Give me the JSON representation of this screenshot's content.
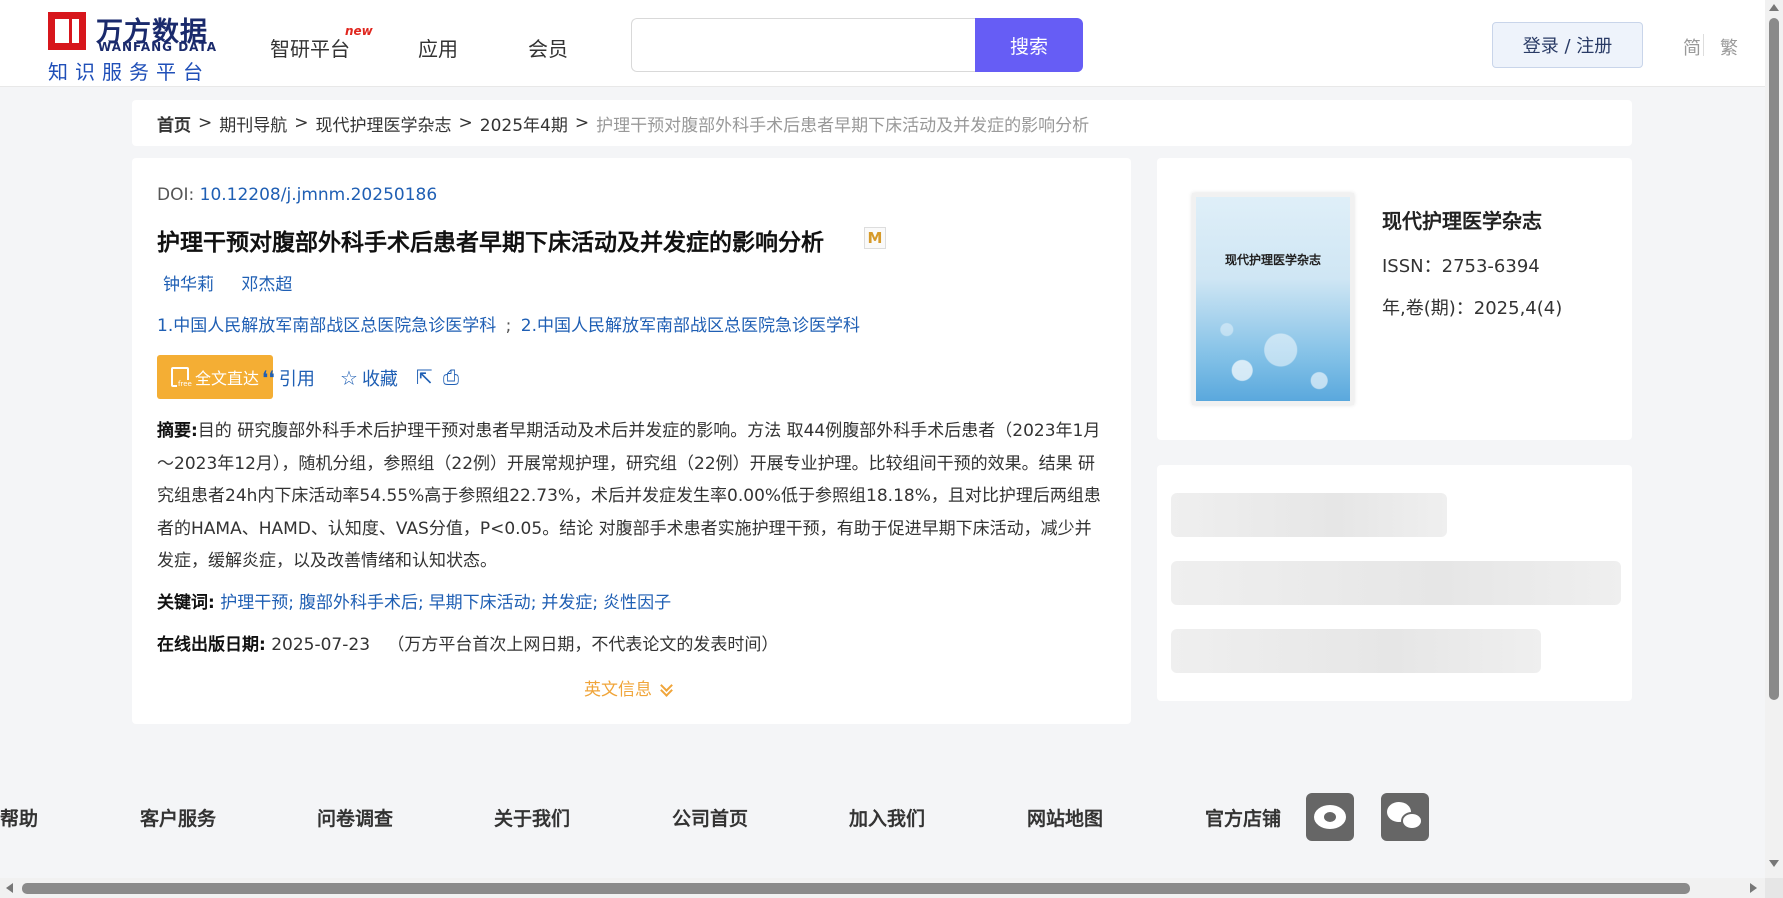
{
  "header": {
    "logo": {
      "cn": "万方数据",
      "en": "WANFANG DATA",
      "sub": "知识服务平台"
    },
    "nav": [
      {
        "label": "智研平台",
        "badge": "new"
      },
      {
        "label": "应用"
      },
      {
        "label": "会员"
      }
    ],
    "search": {
      "value": "",
      "placeholder": "",
      "button": "搜索"
    },
    "login": "登录 / 注册",
    "lang": {
      "simplified": "简",
      "traditional": "繁"
    }
  },
  "breadcrumb": {
    "items": [
      "首页",
      "期刊导航",
      "现代护理医学杂志",
      "2025年4期"
    ],
    "current": "护理干预对腹部外科手术后患者早期下床活动及并发症的影响分析",
    "separator": ">"
  },
  "article": {
    "doi_label": "DOI:",
    "doi": "10.12208/j.jmnm.20250186",
    "title": "护理干预对腹部外科手术后患者早期下床活动及并发症的影响分析",
    "mk_icon_label": "M",
    "authors": [
      "钟华莉",
      "邓杰超"
    ],
    "affiliations": [
      "1.中国人民解放军南部战区总医院急诊医学科",
      "2.中国人民解放军南部战区总医院急诊医学科"
    ],
    "affiliation_separator": ";",
    "actions": {
      "fulltext": "全文直达",
      "cite": "引用",
      "collect": "收藏"
    },
    "abstract_label": "摘要:",
    "abstract": "目的 研究腹部外科手术后护理干预对患者早期活动及术后并发症的影响。方法 取44例腹部外科手术后患者（2023年1月～2023年12月），随机分组，参照组（22例）开展常规护理，研究组（22例）开展专业护理。比较组间干预的效果。结果 研究组患者24h内下床活动率54.55%高于参照组22.73%，术后并发症发生率0.00%低于参照组18.18%，且对比护理后两组患者的HAMA、HAMD、认知度、VAS分值，P<0.05。结论 对腹部手术患者实施护理干预，有助于促进早期下床活动，减少并发症，缓解炎症，以及改善情绪和认知状态。",
    "keywords_label": "关键词:",
    "keywords": [
      "护理干预",
      "腹部外科手术后",
      "早期下床活动",
      "并发症",
      "炎性因子"
    ],
    "keyword_separator": ";",
    "pubdate_label": "在线出版日期:",
    "pubdate": "2025-07-23",
    "pubdate_note": "（万方平台首次上网日期，不代表论文的发表时间）",
    "en_info": "英文信息"
  },
  "journal": {
    "cover_title": "现代护理医学杂志",
    "name": "现代护理医学杂志",
    "issn": "ISSN：2753-6394",
    "volume": "年,卷(期)：2025,4(4)"
  },
  "footer": {
    "links": [
      "帮助",
      "客户服务",
      "问卷调查",
      "关于我们",
      "公司首页",
      "加入我们",
      "网站地图",
      "官方店铺"
    ]
  },
  "colors": {
    "brand_red": "#d7161c",
    "search_button": "#665df5",
    "link_blue": "#1f5fb4",
    "fulltext_orange": "#f4ae34"
  }
}
